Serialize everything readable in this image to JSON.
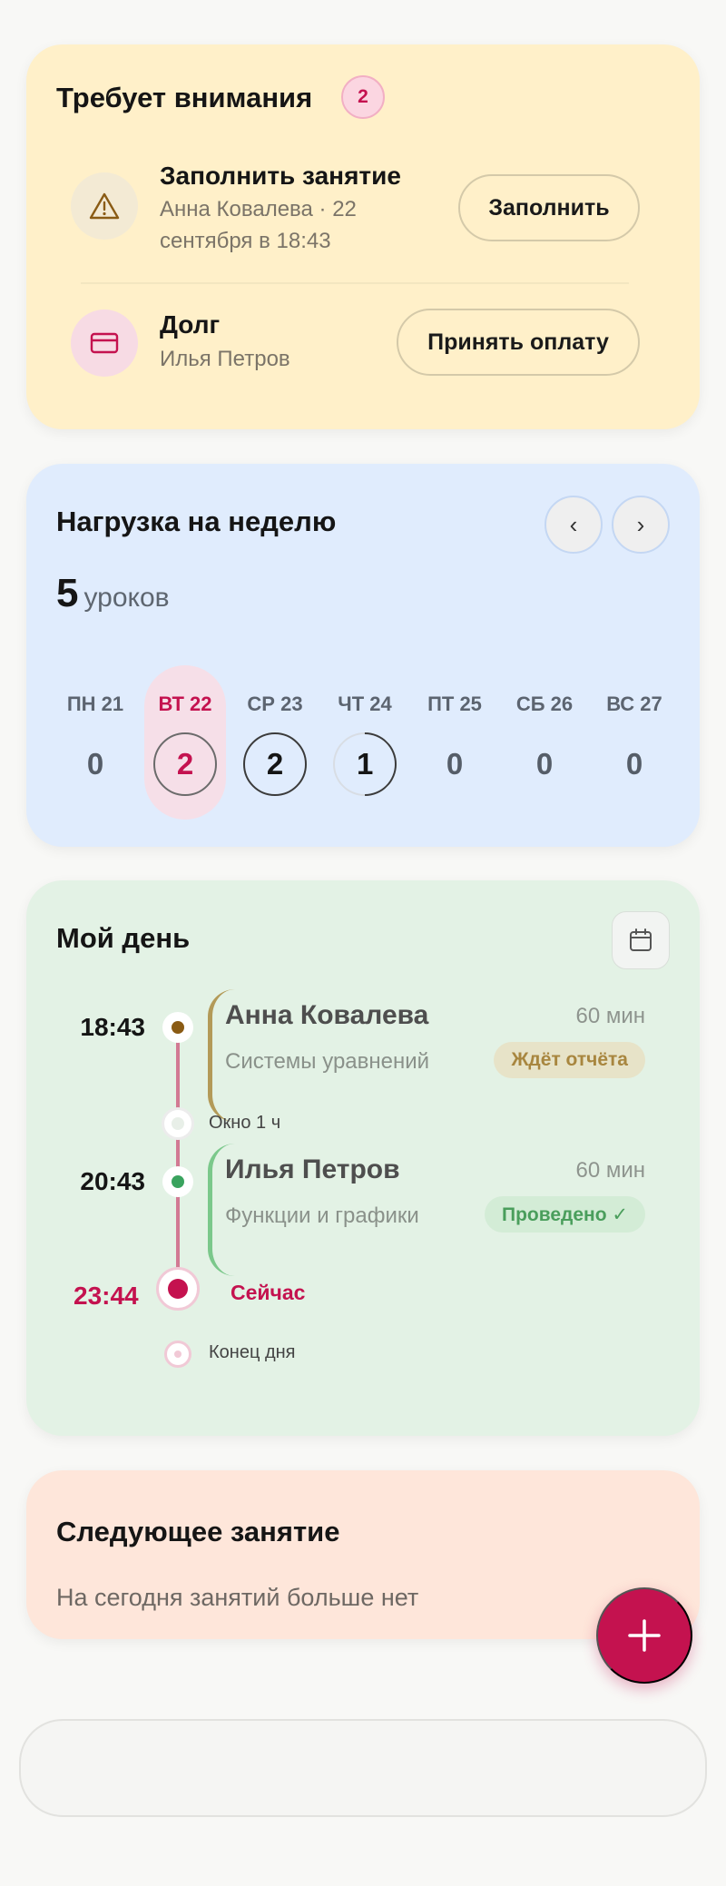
{
  "attention": {
    "title": "Требует внимания",
    "count": "2",
    "items": [
      {
        "icon": "warning-icon",
        "title": "Заполнить занятие",
        "subtitle_line1": "Анна Ковалева · 22",
        "subtitle_line2": "сентября в 18:43",
        "action": "Заполнить"
      },
      {
        "icon": "card-icon",
        "title": "Долг",
        "subtitle_line1": "Илья Петров",
        "action": "Принять оплату"
      }
    ]
  },
  "week": {
    "title": "Нагрузка на неделю",
    "prev": "‹",
    "next": "›",
    "total": "5",
    "total_unit": "уроков",
    "days": [
      {
        "label": "ПН 21",
        "count": "0"
      },
      {
        "label": "ВТ 22",
        "count": "2",
        "active": true
      },
      {
        "label": "СР 23",
        "count": "2"
      },
      {
        "label": "ЧТ 24",
        "count": "1"
      },
      {
        "label": "ПТ 25",
        "count": "0"
      },
      {
        "label": "СБ 26",
        "count": "0"
      },
      {
        "label": "ВС 27",
        "count": "0"
      }
    ]
  },
  "day": {
    "title": "Мой день",
    "lessons": [
      {
        "time": "18:43",
        "name": "Анна Ковалева",
        "duration": "60 мин",
        "topic": "Системы уравнений",
        "status": "Ждёт отчёта"
      },
      {
        "time": "20:43",
        "name": "Илья Петров",
        "duration": "60 мин",
        "topic": "Функции и графики",
        "status": "Проведено ✓"
      }
    ],
    "gap": "Окно 1 ч",
    "now_time": "23:44",
    "now_label": "Сейчас",
    "end_label": "Конец дня"
  },
  "next_lesson": {
    "title": "Следующее занятие",
    "text": "На сегодня занятий больше нет"
  },
  "fab": {
    "icon": "plus-icon"
  },
  "colors": {
    "accent": "#c4124f",
    "attention_bg": "#fff0c9",
    "week_bg": "#e0ecfd",
    "day_bg": "#e3f2e5",
    "next_bg": "#fee6da",
    "pending": "#a8863f",
    "done": "#4a9e5c"
  }
}
